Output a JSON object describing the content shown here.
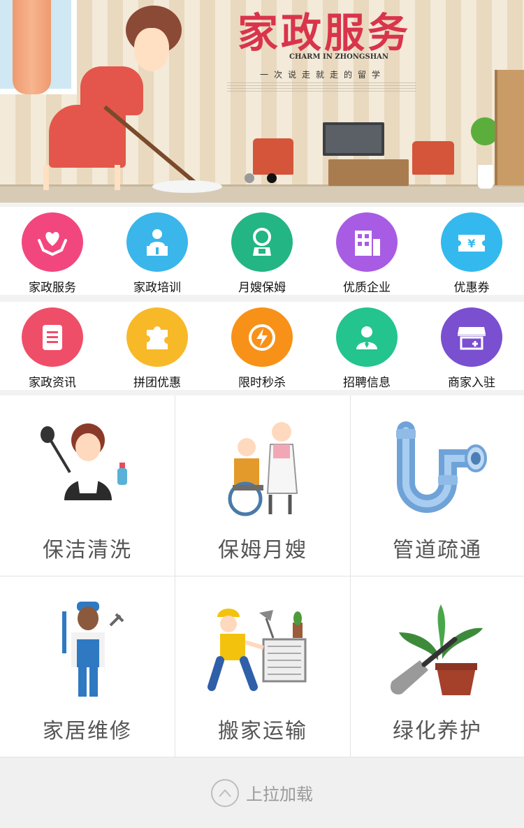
{
  "banner": {
    "title": "家政服务",
    "subtitle_en": "CHARM IN ZHONGSHAN",
    "subtitle_cn": "一次说走就走的留学",
    "slide_count": 2,
    "active_slide": 2
  },
  "row1": [
    {
      "label": "家政服务",
      "icon": "hands-heart-icon",
      "color": "#f2477e"
    },
    {
      "label": "家政培训",
      "icon": "teacher-podium-icon",
      "color": "#3ab6ea"
    },
    {
      "label": "月嫂保姆",
      "icon": "nanny-icon",
      "color": "#23b583"
    },
    {
      "label": "优质企业",
      "icon": "building-icon",
      "color": "#a85ce4"
    },
    {
      "label": "优惠券",
      "icon": "coupon-icon",
      "color": "#34b9ee"
    }
  ],
  "row2": [
    {
      "label": "家政资讯",
      "icon": "document-icon",
      "color": "#ef4e69"
    },
    {
      "label": "拼团优惠",
      "icon": "puzzle-icon",
      "color": "#f8b928"
    },
    {
      "label": "限时秒杀",
      "icon": "lightning-icon",
      "color": "#f89118"
    },
    {
      "label": "招聘信息",
      "icon": "person-badge-icon",
      "color": "#23c48e"
    },
    {
      "label": "商家入驻",
      "icon": "storefront-icon",
      "color": "#7a4fd0"
    }
  ],
  "services": [
    {
      "label": "保洁清洗",
      "icon": "cleaning-maid-icon"
    },
    {
      "label": "保姆月嫂",
      "icon": "caregiver-wheelchair-icon"
    },
    {
      "label": "管道疏通",
      "icon": "pipe-icon"
    },
    {
      "label": "家居维修",
      "icon": "repairman-icon"
    },
    {
      "label": "搬家运输",
      "icon": "mover-icon"
    },
    {
      "label": "绿化养护",
      "icon": "trowel-plant-icon"
    }
  ],
  "footer": {
    "label": "上拉加载",
    "icon": "chevron-up-icon"
  }
}
